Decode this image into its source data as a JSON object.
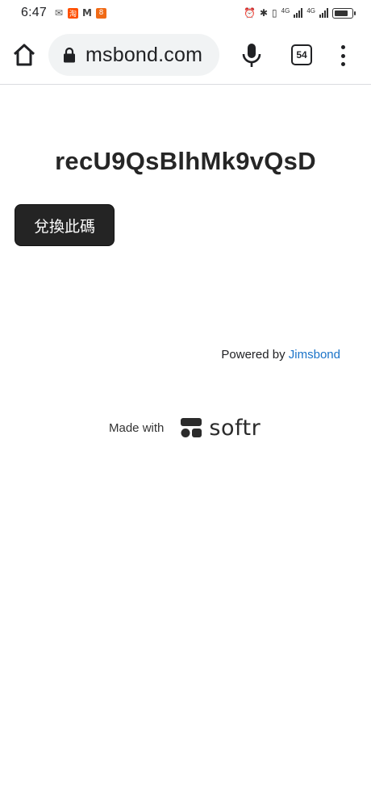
{
  "status_bar": {
    "time": "6:47",
    "notification_icons": [
      "wechat-icon",
      "taobao-icon",
      "gmail-icon",
      "app-icon"
    ],
    "network_label_1": "4G",
    "network_label_2": "4G"
  },
  "browser": {
    "url": "msbond.com",
    "tab_count": "54"
  },
  "page": {
    "code": "recU9QsBlhMk9vQsD",
    "redeem_button_label": "兌換此碼",
    "powered_by_prefix": "Powered by ",
    "powered_by_link": "Jimsbond",
    "made_with_label": "Made with",
    "brand_name": "softr"
  },
  "colors": {
    "button_bg": "#242424",
    "link": "#1a73c8",
    "omnibox_bg": "#f1f3f4"
  }
}
